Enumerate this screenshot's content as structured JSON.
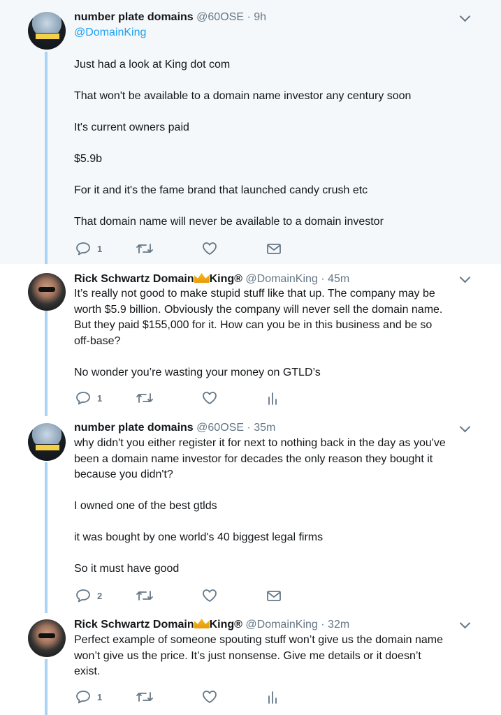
{
  "tweets": [
    {
      "name": "number plate domains",
      "handle": "@60OSE",
      "time": "9h",
      "reply_to": "@DomainKing",
      "paragraphs": [
        "Just had a look at King dot com",
        "That won't be available to a domain name investor any century soon",
        "It's current owners paid",
        "$5.9b",
        "For it and it's the fame brand that launched candy crush etc",
        "That domain name will never be available to a domain investor"
      ],
      "reply_count": "1",
      "fourth_icon": "mail-icon"
    },
    {
      "name_part1": "Rick Schwartz Domain",
      "name_part2": "King®",
      "handle": "@DomainKing",
      "time": "45m",
      "lines": [
        "It’s really not good to make stupid stuff like that up. The company may be",
        "worth $5.9 billion. Obviously the company will never sell the domain name.",
        "But they paid $155,000 for it. How can you be in this business and be so",
        "off-base?"
      ],
      "paragraph2": "No wonder you’re wasting your money on GTLD’s",
      "reply_count": "1",
      "fourth_icon": "analytics-icon"
    },
    {
      "name": "number plate domains",
      "handle": "@60OSE",
      "time": "35m",
      "lines": [
        "why didn't you either register it for next to nothing back in the day as you've",
        "been a domain name investor for decades the only reason they bought it",
        "because you didn't?"
      ],
      "paragraphs": [
        "I owned one of the best gtlds",
        "it was bought by one world's 40 biggest legal firms",
        "So it must have good"
      ],
      "reply_count": "2",
      "fourth_icon": "mail-icon"
    },
    {
      "name_part1": "Rick Schwartz Domain",
      "name_part2": "King®",
      "handle": "@DomainKing",
      "time": "32m",
      "lines": [
        "Perfect example of someone spouting stuff won’t give us the domain name",
        "won’t give us the price.  It’s just nonsense. Give me details or it doesn’t",
        "exist."
      ],
      "reply_count": "1",
      "fourth_icon": "analytics-icon"
    }
  ],
  "separator": "·",
  "colors": {
    "link": "#1da1f2",
    "muted": "#657786",
    "thread": "#a9d4f5",
    "highlight_bg": "#f5f8fa"
  }
}
